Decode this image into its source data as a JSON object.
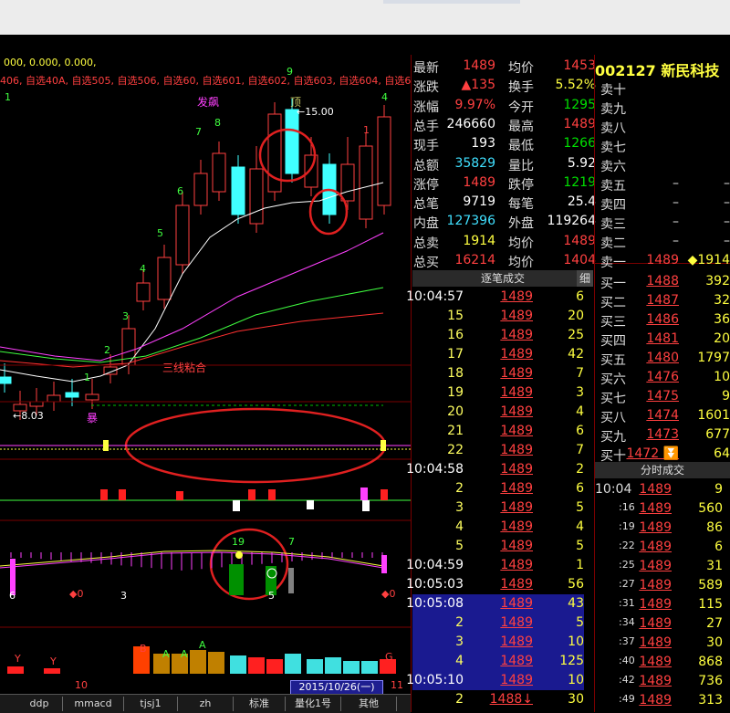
{
  "colors": {
    "up": "#ff4040",
    "down": "#40ffff",
    "text_yellow": "#ffff40",
    "highlight": "#1a1a90"
  },
  "chart": {
    "header_values": "000, 0.000, 0.000,",
    "watch_labels": "406, 自选40A, 自选505, 自选506, 自选60, 自选601, 自选602, 自选603, 自选604, 自选605",
    "annotation_fabiao": "发飙",
    "annotation_ding": "顶",
    "annotation_price_high": "15.00",
    "annotation_price_low": "8.03",
    "annotation_sanxian": "三线粘合",
    "annotation_bao": "暴",
    "count_labels": [
      "1",
      "2",
      "3",
      "4",
      "5",
      "6",
      "7",
      "8",
      "9",
      "1",
      "4",
      "1"
    ],
    "macd_labels": {
      "left": "6",
      "mid": "3",
      "d0a": "0",
      "d0b": "0",
      "n19": "19",
      "n7": "7",
      "n5": "5"
    },
    "vol_letters": [
      "Y",
      "Y",
      "B",
      "A",
      "A",
      "A",
      "G"
    ],
    "bottom_marker": "10",
    "bottom_marker_right": "11",
    "date": "2015/10/26(一)",
    "tabs": [
      "ddp",
      "mmacd",
      "tjsj1",
      "zh",
      "标准",
      "量化1号",
      "其他"
    ]
  },
  "quote": {
    "rows": [
      {
        "l": "最新",
        "v": "1489",
        "l2": "均价",
        "v2": "1453"
      },
      {
        "l": "涨跌",
        "v": "▲135",
        "l2": "换手",
        "v2": "5.52%"
      },
      {
        "l": "涨幅",
        "v": "9.97%",
        "l2": "今开",
        "v2": "1295"
      },
      {
        "l": "总手",
        "v": "246660",
        "l2": "最高",
        "v2": "1489"
      },
      {
        "l": "现手",
        "v": "193",
        "l2": "最低",
        "v2": "1266"
      },
      {
        "l": "总额",
        "v": "35829",
        "l2": "量比",
        "v2": "5.92"
      },
      {
        "l": "涨停",
        "v": "1489",
        "l2": "跌停",
        "v2": "1219"
      },
      {
        "l": "总笔",
        "v": "9719",
        "l2": "每笔",
        "v2": "25.4"
      },
      {
        "l": "内盘",
        "v": "127396",
        "l2": "外盘",
        "v2": "119264"
      },
      {
        "l": "总卖",
        "v": "1914",
        "l2": "均价",
        "v2": "1489"
      },
      {
        "l": "总买",
        "v": "16214",
        "l2": "均价",
        "v2": "1404"
      }
    ]
  },
  "ticks": {
    "header": "逐笔成交",
    "header_btn": "细",
    "rows": [
      {
        "t": "10:04:57",
        "p": "1489",
        "v": "6"
      },
      {
        "t": "15",
        "p": "1489",
        "v": "20"
      },
      {
        "t": "16",
        "p": "1489",
        "v": "25"
      },
      {
        "t": "17",
        "p": "1489",
        "v": "42"
      },
      {
        "t": "18",
        "p": "1489",
        "v": "7"
      },
      {
        "t": "19",
        "p": "1489",
        "v": "3"
      },
      {
        "t": "20",
        "p": "1489",
        "v": "4"
      },
      {
        "t": "21",
        "p": "1489",
        "v": "6"
      },
      {
        "t": "22",
        "p": "1489",
        "v": "7"
      },
      {
        "t": "10:04:58",
        "p": "1489",
        "v": "2"
      },
      {
        "t": "2",
        "p": "1489",
        "v": "6"
      },
      {
        "t": "3",
        "p": "1489",
        "v": "5"
      },
      {
        "t": "4",
        "p": "1489",
        "v": "4"
      },
      {
        "t": "5",
        "p": "1489",
        "v": "5"
      },
      {
        "t": "10:04:59",
        "p": "1489",
        "v": "1"
      },
      {
        "t": "10:05:03",
        "p": "1489",
        "v": "56"
      },
      {
        "t": "10:05:08",
        "p": "1489",
        "v": "43"
      },
      {
        "t": "2",
        "p": "1489",
        "v": "5"
      },
      {
        "t": "3",
        "p": "1489",
        "v": "10"
      },
      {
        "t": "4",
        "p": "1489",
        "v": "125"
      },
      {
        "t": "10:05:10",
        "p": "1489",
        "v": "10"
      },
      {
        "t": "2",
        "p": "1488↓",
        "v": "30"
      }
    ]
  },
  "stock": {
    "code": "002127",
    "name": "新民科技"
  },
  "orderbook": {
    "asks": [
      {
        "l": "卖十",
        "p": "",
        "v": ""
      },
      {
        "l": "卖九",
        "p": "",
        "v": ""
      },
      {
        "l": "卖八",
        "p": "",
        "v": ""
      },
      {
        "l": "卖七",
        "p": "",
        "v": ""
      },
      {
        "l": "卖六",
        "p": "",
        "v": ""
      },
      {
        "l": "卖五",
        "p": "–",
        "v": "–"
      },
      {
        "l": "卖四",
        "p": "–",
        "v": "–"
      },
      {
        "l": "卖三",
        "p": "–",
        "v": "–"
      },
      {
        "l": "卖二",
        "p": "–",
        "v": "–"
      },
      {
        "l": "卖一",
        "p": "1489",
        "v": "◆1914"
      }
    ],
    "bids": [
      {
        "l": "买一",
        "p": "1488",
        "v": "392"
      },
      {
        "l": "买二",
        "p": "1487",
        "v": "32"
      },
      {
        "l": "买三",
        "p": "1486",
        "v": "36"
      },
      {
        "l": "买四",
        "p": "1481",
        "v": "20"
      },
      {
        "l": "买五",
        "p": "1480",
        "v": "1797"
      },
      {
        "l": "买六",
        "p": "1476",
        "v": "10"
      },
      {
        "l": "买七",
        "p": "1475",
        "v": "9"
      },
      {
        "l": "买八",
        "p": "1474",
        "v": "1601"
      },
      {
        "l": "买九",
        "p": "1473",
        "v": "677"
      },
      {
        "l": "买十",
        "p": "1472 ⏬",
        "v": "64"
      }
    ]
  },
  "minute_ticks": {
    "header": "分时成交",
    "rows": [
      {
        "t": "10:04",
        "p": "1489",
        "v": "9"
      },
      {
        "t": ":16",
        "p": "1489",
        "v": "560"
      },
      {
        "t": ":19",
        "p": "1489",
        "v": "86"
      },
      {
        "t": ":22",
        "p": "1489",
        "v": "6"
      },
      {
        "t": ":25",
        "p": "1489",
        "v": "31"
      },
      {
        "t": ":27",
        "p": "1489",
        "v": "589"
      },
      {
        "t": ":31",
        "p": "1489",
        "v": "115"
      },
      {
        "t": ":34",
        "p": "1489",
        "v": "27"
      },
      {
        "t": ":37",
        "p": "1489",
        "v": "30"
      },
      {
        "t": ":40",
        "p": "1489",
        "v": "868"
      },
      {
        "t": ":42",
        "p": "1489",
        "v": "736"
      },
      {
        "t": ":49",
        "p": "1489",
        "v": "313"
      }
    ]
  }
}
